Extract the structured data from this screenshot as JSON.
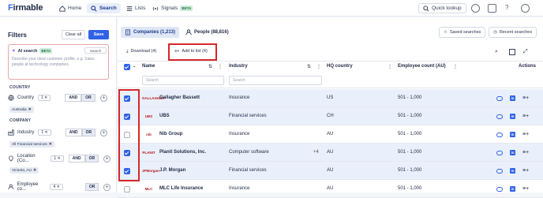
{
  "app": {
    "logo_prefix": "F",
    "logo_rest": "irmable"
  },
  "nav": {
    "home": "Home",
    "search": "Search",
    "lists": "Lists",
    "signals": "Signals",
    "signals_badge": "BETA",
    "quick_lookup": "Quick lookup"
  },
  "filters": {
    "title": "Filters",
    "clear_all": "Clear all",
    "save": "Save",
    "ai_search": {
      "label": "AI search",
      "badge": "BETA",
      "search_btn": "Search",
      "placeholder": "Describe your ideal customer profile, e.g. Sales people at technology companies"
    },
    "country_section": "COUNTRY",
    "company_section": "COMPANY",
    "country": {
      "label": "Country",
      "count": "1",
      "and": "AND",
      "or": "OR",
      "tag": "Australia"
    },
    "industry": {
      "label": "Industry",
      "count": "1",
      "and": "AND",
      "or": "OR",
      "tag": "All Financial services"
    },
    "location": {
      "label": "Location (Co...",
      "count": "1",
      "and": "AND",
      "or": "OR",
      "tag": "Victoria, AU"
    },
    "employee": {
      "label": "Employee co...",
      "count": "4",
      "or": "OR"
    }
  },
  "tabs": {
    "companies": "Companies (1,213)",
    "people": "People (88,816)"
  },
  "toolbar": {
    "saved_searches": "Saved searches",
    "recent_searches": "Recent searches",
    "download": "Download (4)",
    "add_to_list": "Add to list (4)"
  },
  "table": {
    "headers": {
      "name": "Name",
      "industry": "Industry",
      "hq": "HQ country",
      "employees": "Employee count (AU)",
      "actions": "Actions"
    },
    "search_placeholder": "Search",
    "rows": [
      {
        "logo": "GALLAGHER",
        "name": "Gallagher Bassett",
        "industry": "Insurance",
        "extra": "",
        "hq": "US",
        "employees": "501 - 1,000",
        "checked": true
      },
      {
        "logo": "UBS",
        "name": "UBS",
        "industry": "Financial services",
        "extra": "",
        "hq": "CH",
        "employees": "501 - 1,000",
        "checked": true
      },
      {
        "logo": "nib",
        "name": "Nib Group",
        "industry": "Insurance",
        "extra": "",
        "hq": "AU",
        "employees": "501 - 1,000",
        "checked": false
      },
      {
        "logo": "PLANIT",
        "name": "Planit Solutions, Inc.",
        "industry": "Computer software",
        "extra": "+4",
        "hq": "AU",
        "employees": "501 - 1,000",
        "checked": true
      },
      {
        "logo": "JPMorgan",
        "name": "J.P. Morgan",
        "industry": "Financial services",
        "extra": "",
        "hq": "AU",
        "employees": "501 - 1,000",
        "checked": true
      },
      {
        "logo": "MLC",
        "name": "MLC Life Insurance",
        "industry": "Insurance",
        "extra": "",
        "hq": "AU",
        "employees": "501 - 1,000",
        "checked": false
      }
    ]
  },
  "colors": {
    "accent": "#2f62e6",
    "highlight": "#d6272b",
    "selected_row": "#eaf0fb"
  }
}
